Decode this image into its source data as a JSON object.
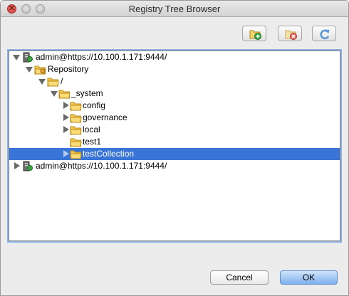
{
  "window": {
    "title": "Registry Tree Browser"
  },
  "toolbar": {
    "add_icon": "add-collection-icon",
    "remove_icon": "remove-collection-icon",
    "refresh_icon": "refresh-icon"
  },
  "tree": {
    "items": [
      {
        "label": "admin@https://10.100.1.171:9444/",
        "icon": "server-icon",
        "expanded": true
      },
      {
        "label": "Repository",
        "icon": "folder-icon",
        "expanded": true
      },
      {
        "label": "/",
        "icon": "folder-icon",
        "expanded": true
      },
      {
        "label": "_system",
        "icon": "folder-icon",
        "expanded": true
      },
      {
        "label": "config",
        "icon": "folder-icon",
        "expanded": false
      },
      {
        "label": "governance",
        "icon": "folder-icon",
        "expanded": false
      },
      {
        "label": "local",
        "icon": "folder-icon",
        "expanded": false
      },
      {
        "label": "test1",
        "icon": "folder-icon",
        "expanded": false
      },
      {
        "label": "testCollection",
        "icon": "folder-icon",
        "expanded": false,
        "selected": true
      },
      {
        "label": "admin@https://10.100.1.171:9444/",
        "icon": "server-icon",
        "expanded": false
      }
    ]
  },
  "buttons": {
    "cancel": "Cancel",
    "ok": "OK"
  }
}
